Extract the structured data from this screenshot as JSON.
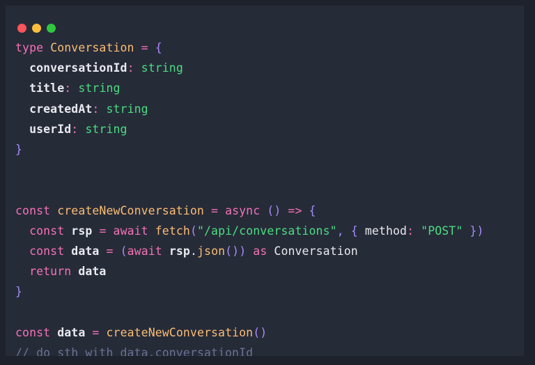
{
  "window": {
    "traffic_lights": [
      {
        "name": "close",
        "color": "#f9555a"
      },
      {
        "name": "minimize",
        "color": "#fbbe3c"
      },
      {
        "name": "maximize",
        "color": "#2fc840"
      }
    ],
    "background": "#262b38",
    "frame_background": "#1e222c"
  },
  "theme": {
    "keyword": "#f472b6",
    "type": "#fbbd74",
    "function": "#fbbd74",
    "string": "#4ade80",
    "punctuation": "#a78bfa",
    "identifier": "#e8eaf0",
    "comment": "#6b7394"
  },
  "code": {
    "language": "typescript",
    "lines": [
      {
        "n": 1,
        "text": "type Conversation = {",
        "tokens": [
          {
            "t": "type",
            "c": "kw"
          },
          {
            "t": " ",
            "c": "plain"
          },
          {
            "t": "Conversation",
            "c": "type"
          },
          {
            "t": " ",
            "c": "plain"
          },
          {
            "t": "=",
            "c": "op"
          },
          {
            "t": " ",
            "c": "plain"
          },
          {
            "t": "{",
            "c": "punc"
          }
        ]
      },
      {
        "n": 2,
        "text": "  conversationId: string",
        "tokens": [
          {
            "t": "  ",
            "c": "plain"
          },
          {
            "t": "conversationId",
            "c": "id"
          },
          {
            "t": ":",
            "c": "colon"
          },
          {
            "t": " ",
            "c": "plain"
          },
          {
            "t": "string",
            "c": "str"
          }
        ]
      },
      {
        "n": 3,
        "text": "  title: string",
        "tokens": [
          {
            "t": "  ",
            "c": "plain"
          },
          {
            "t": "title",
            "c": "id"
          },
          {
            "t": ":",
            "c": "colon"
          },
          {
            "t": " ",
            "c": "plain"
          },
          {
            "t": "string",
            "c": "str"
          }
        ]
      },
      {
        "n": 4,
        "text": "  createdAt: string",
        "tokens": [
          {
            "t": "  ",
            "c": "plain"
          },
          {
            "t": "createdAt",
            "c": "id"
          },
          {
            "t": ":",
            "c": "colon"
          },
          {
            "t": " ",
            "c": "plain"
          },
          {
            "t": "string",
            "c": "str"
          }
        ]
      },
      {
        "n": 5,
        "text": "  userId: string",
        "tokens": [
          {
            "t": "  ",
            "c": "plain"
          },
          {
            "t": "userId",
            "c": "id"
          },
          {
            "t": ":",
            "c": "colon"
          },
          {
            "t": " ",
            "c": "plain"
          },
          {
            "t": "string",
            "c": "str"
          }
        ]
      },
      {
        "n": 6,
        "text": "}",
        "tokens": [
          {
            "t": "}",
            "c": "punc"
          }
        ]
      },
      {
        "n": 7,
        "text": "",
        "tokens": []
      },
      {
        "n": 8,
        "text": "",
        "tokens": []
      },
      {
        "n": 9,
        "text": "const createNewConversation = async () => {",
        "tokens": [
          {
            "t": "const",
            "c": "kw"
          },
          {
            "t": " ",
            "c": "plain"
          },
          {
            "t": "createNewConversation",
            "c": "fn"
          },
          {
            "t": " ",
            "c": "plain"
          },
          {
            "t": "=",
            "c": "op"
          },
          {
            "t": " ",
            "c": "plain"
          },
          {
            "t": "async",
            "c": "kw"
          },
          {
            "t": " ",
            "c": "plain"
          },
          {
            "t": "()",
            "c": "punc"
          },
          {
            "t": " ",
            "c": "plain"
          },
          {
            "t": "=>",
            "c": "op"
          },
          {
            "t": " ",
            "c": "plain"
          },
          {
            "t": "{",
            "c": "punc"
          }
        ]
      },
      {
        "n": 10,
        "text": "  const rsp = await fetch(\"/api/conversations\", { method: \"POST\" })",
        "tokens": [
          {
            "t": "  ",
            "c": "plain"
          },
          {
            "t": "const",
            "c": "kw"
          },
          {
            "t": " ",
            "c": "plain"
          },
          {
            "t": "rsp",
            "c": "id"
          },
          {
            "t": " ",
            "c": "plain"
          },
          {
            "t": "=",
            "c": "op"
          },
          {
            "t": " ",
            "c": "plain"
          },
          {
            "t": "await",
            "c": "kw"
          },
          {
            "t": " ",
            "c": "plain"
          },
          {
            "t": "fetch",
            "c": "fn"
          },
          {
            "t": "(",
            "c": "punc"
          },
          {
            "t": "\"/api/conversations\"",
            "c": "str"
          },
          {
            "t": ",",
            "c": "punc"
          },
          {
            "t": " ",
            "c": "plain"
          },
          {
            "t": "{",
            "c": "punc"
          },
          {
            "t": " ",
            "c": "plain"
          },
          {
            "t": "method",
            "c": "plain"
          },
          {
            "t": ":",
            "c": "colon"
          },
          {
            "t": " ",
            "c": "plain"
          },
          {
            "t": "\"POST\"",
            "c": "str"
          },
          {
            "t": " ",
            "c": "plain"
          },
          {
            "t": "})",
            "c": "punc"
          }
        ]
      },
      {
        "n": 11,
        "text": "  const data = (await rsp.json()) as Conversation",
        "tokens": [
          {
            "t": "  ",
            "c": "plain"
          },
          {
            "t": "const",
            "c": "kw"
          },
          {
            "t": " ",
            "c": "plain"
          },
          {
            "t": "data",
            "c": "id"
          },
          {
            "t": " ",
            "c": "plain"
          },
          {
            "t": "=",
            "c": "op"
          },
          {
            "t": " ",
            "c": "plain"
          },
          {
            "t": "(",
            "c": "punc"
          },
          {
            "t": "await",
            "c": "kw"
          },
          {
            "t": " ",
            "c": "plain"
          },
          {
            "t": "rsp",
            "c": "id"
          },
          {
            "t": ".",
            "c": "plain"
          },
          {
            "t": "json",
            "c": "fn"
          },
          {
            "t": "())",
            "c": "punc"
          },
          {
            "t": " ",
            "c": "plain"
          },
          {
            "t": "as",
            "c": "kw"
          },
          {
            "t": " ",
            "c": "plain"
          },
          {
            "t": "Conversation",
            "c": "plain"
          }
        ]
      },
      {
        "n": 12,
        "text": "  return data",
        "tokens": [
          {
            "t": "  ",
            "c": "plain"
          },
          {
            "t": "return",
            "c": "kw"
          },
          {
            "t": " ",
            "c": "plain"
          },
          {
            "t": "data",
            "c": "id"
          }
        ]
      },
      {
        "n": 13,
        "text": "}",
        "tokens": [
          {
            "t": "}",
            "c": "punc"
          }
        ]
      },
      {
        "n": 14,
        "text": "",
        "tokens": []
      },
      {
        "n": 15,
        "text": "const data = createNewConversation()",
        "tokens": [
          {
            "t": "const",
            "c": "kw"
          },
          {
            "t": " ",
            "c": "plain"
          },
          {
            "t": "data",
            "c": "id"
          },
          {
            "t": " ",
            "c": "plain"
          },
          {
            "t": "=",
            "c": "op"
          },
          {
            "t": " ",
            "c": "plain"
          },
          {
            "t": "createNewConversation",
            "c": "fn"
          },
          {
            "t": "()",
            "c": "punc"
          }
        ]
      },
      {
        "n": 16,
        "text": "// do sth with data.conversationId",
        "tokens": [
          {
            "t": "// do sth with data.conversationId",
            "c": "com"
          }
        ]
      }
    ]
  }
}
